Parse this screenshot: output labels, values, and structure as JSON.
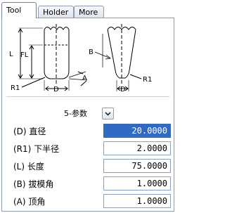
{
  "tabs": [
    {
      "label": "Tool",
      "active": true
    },
    {
      "label": "Holder",
      "active": false
    },
    {
      "label": "More",
      "active": false
    }
  ],
  "diagram": {
    "left_labels": [
      "L",
      "FL",
      "R1",
      "D",
      "A"
    ],
    "right_labels": [
      "B",
      "D",
      "R1"
    ]
  },
  "parameter_set": {
    "selected": "5-参数"
  },
  "fields": [
    {
      "label": "(D) 直径",
      "value": "20.0000",
      "selected": true
    },
    {
      "label": "(R1) 下半径",
      "value": "2.0000",
      "selected": false
    },
    {
      "label": "(L) 长度",
      "value": "75.0000",
      "selected": false
    },
    {
      "label": "(B) 拔模角",
      "value": "1.0000",
      "selected": false
    },
    {
      "label": "(A) 顶角",
      "value": "1.0000",
      "selected": false
    }
  ],
  "colors": {
    "selection": "#316ac5",
    "tab_border": "#8d9bb3",
    "field_border": "#8ea0c2"
  }
}
